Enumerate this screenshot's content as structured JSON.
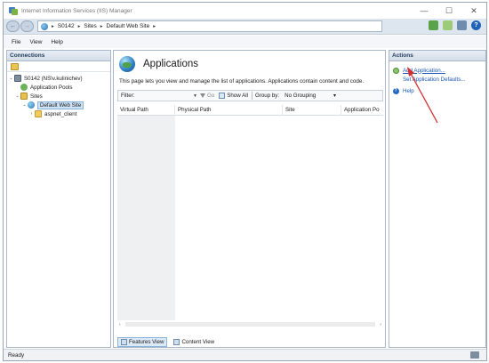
{
  "window": {
    "title": "Internet Information Services (IIS) Manager",
    "controls": {
      "minimize": "—",
      "maximize": "☐",
      "close": "✕"
    }
  },
  "addressbar": {
    "back": "←",
    "forward": "→",
    "path": [
      "S0142",
      "Sites",
      "Default Web Site"
    ],
    "separator": "▸"
  },
  "menu": {
    "items": [
      "File",
      "View",
      "Help"
    ]
  },
  "connections": {
    "header": "Connections",
    "tree": [
      {
        "label": "S0142 (NS\\v.kulinichev)",
        "expander": "⌄",
        "icon": "server-icon",
        "indent": 0
      },
      {
        "label": "Application Pools",
        "expander": "",
        "icon": "application-pools-icon",
        "indent": 1
      },
      {
        "label": "Sites",
        "expander": "⌄",
        "icon": "sites-folder-icon",
        "indent": 1
      },
      {
        "label": "Default Web Site",
        "expander": "⌄",
        "icon": "website-globe-icon",
        "indent": 2,
        "selected": true
      },
      {
        "label": "aspnet_client",
        "expander": "›",
        "icon": "folder-icon",
        "indent": 3
      }
    ]
  },
  "main": {
    "title": "Applications",
    "description": "This page lets you view and manage the list of applications. Applications contain content and code.",
    "filter": {
      "label": "Filter:",
      "go": "Go",
      "show_all": "Show All",
      "group_by_label": "Group by:",
      "group_by_value": "No Grouping"
    },
    "columns": [
      "Virtual Path",
      "Physical Path",
      "Site",
      "Application Po"
    ],
    "rows": [],
    "scroll": {
      "left": "‹",
      "right": "›"
    },
    "view_tabs": {
      "features": "Features View",
      "content": "Content View"
    }
  },
  "actions": {
    "header": "Actions",
    "items": [
      {
        "label": "Add Application...",
        "icon": "add-application-icon",
        "style": "link"
      },
      {
        "label": "Set Application Defaults...",
        "icon": "",
        "style": "link-plain"
      },
      {
        "label": "Help",
        "icon": "help-icon",
        "style": "link-plain"
      }
    ]
  },
  "status": {
    "text": "Ready"
  },
  "colors": {
    "annotation_arrow": "#d32f2f",
    "link": "#1b56b2",
    "selection": "#cde3f7"
  }
}
